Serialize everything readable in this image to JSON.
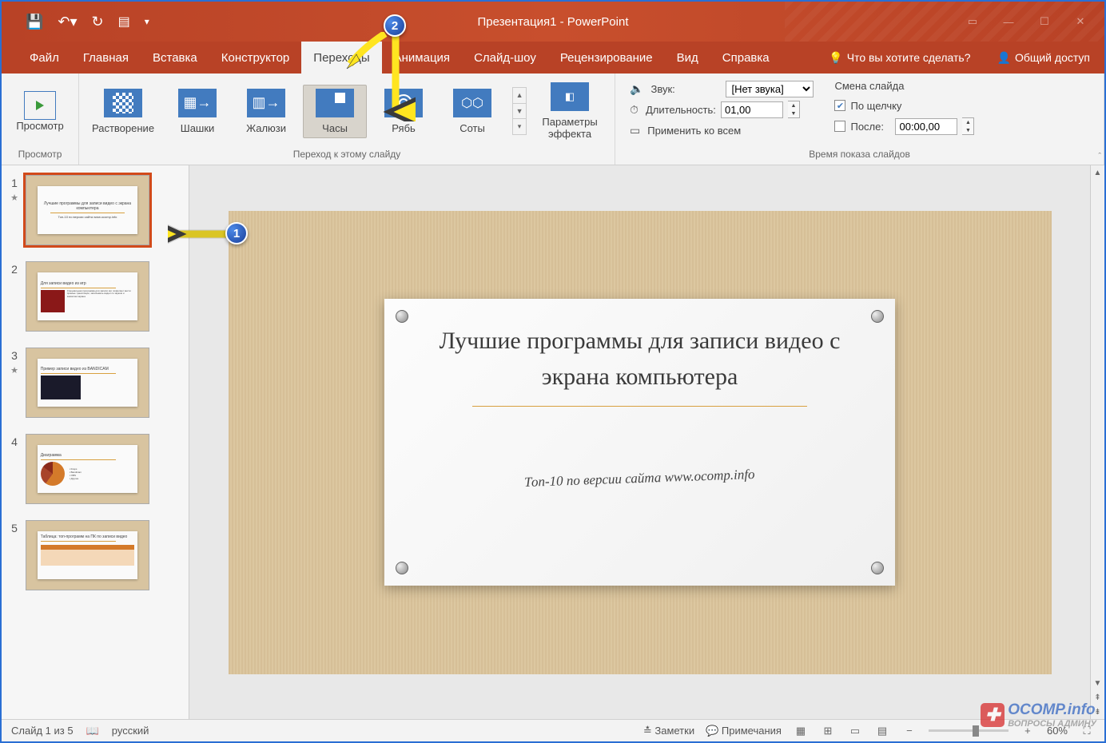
{
  "title": "Презентация1 - PowerPoint",
  "tabs": {
    "file": "Файл",
    "home": "Главная",
    "insert": "Вставка",
    "design": "Конструктор",
    "transitions": "Переходы",
    "animations": "Анимация",
    "slideshow": "Слайд-шоу",
    "review": "Рецензирование",
    "view": "Вид",
    "help": "Справка"
  },
  "tell_me": "Что вы хотите сделать?",
  "share": "Общий доступ",
  "ribbon": {
    "preview_btn": "Просмотр",
    "preview_group": "Просмотр",
    "transitions": {
      "dissolve": "Растворение",
      "checker": "Шашки",
      "blinds": "Жалюзи",
      "clock": "Часы",
      "ripple": "Рябь",
      "honeycomb": "Соты"
    },
    "effect_options": "Параметры\nэффекта",
    "transition_group": "Переход к этому слайду",
    "sound_label": "Звук:",
    "sound_value": "[Нет звука]",
    "duration_label": "Длительность:",
    "duration_value": "01,00",
    "apply_all": "Применить ко всем",
    "advance_title": "Смена слайда",
    "on_click": "По щелчку",
    "after_label": "После:",
    "after_value": "00:00,00",
    "timing_group": "Время показа слайдов"
  },
  "slide": {
    "title": "Лучшие программы для записи видео с экрана компьютера",
    "subtitle": "Топ-10 по версии сайта www.ocomp.info"
  },
  "thumbs": {
    "t1": "Лучшие программы для записи видео с экрана компьютера",
    "t2": "Для записи видео из игр",
    "t3": "Пример записи видео из BANDICAM",
    "t4_title": "Диаграмма",
    "t5": "Таблица: топ-программ на ПК по записи видео"
  },
  "status": {
    "slide_count": "Слайд 1 из 5",
    "lang": "русский",
    "notes": "Заметки",
    "comments": "Примечания",
    "zoom": "60%"
  },
  "watermark": {
    "line1": "OCOMP.info",
    "line2": "ВОПРОСЫ АДМИНУ"
  },
  "callouts": {
    "one": "1",
    "two": "2"
  }
}
